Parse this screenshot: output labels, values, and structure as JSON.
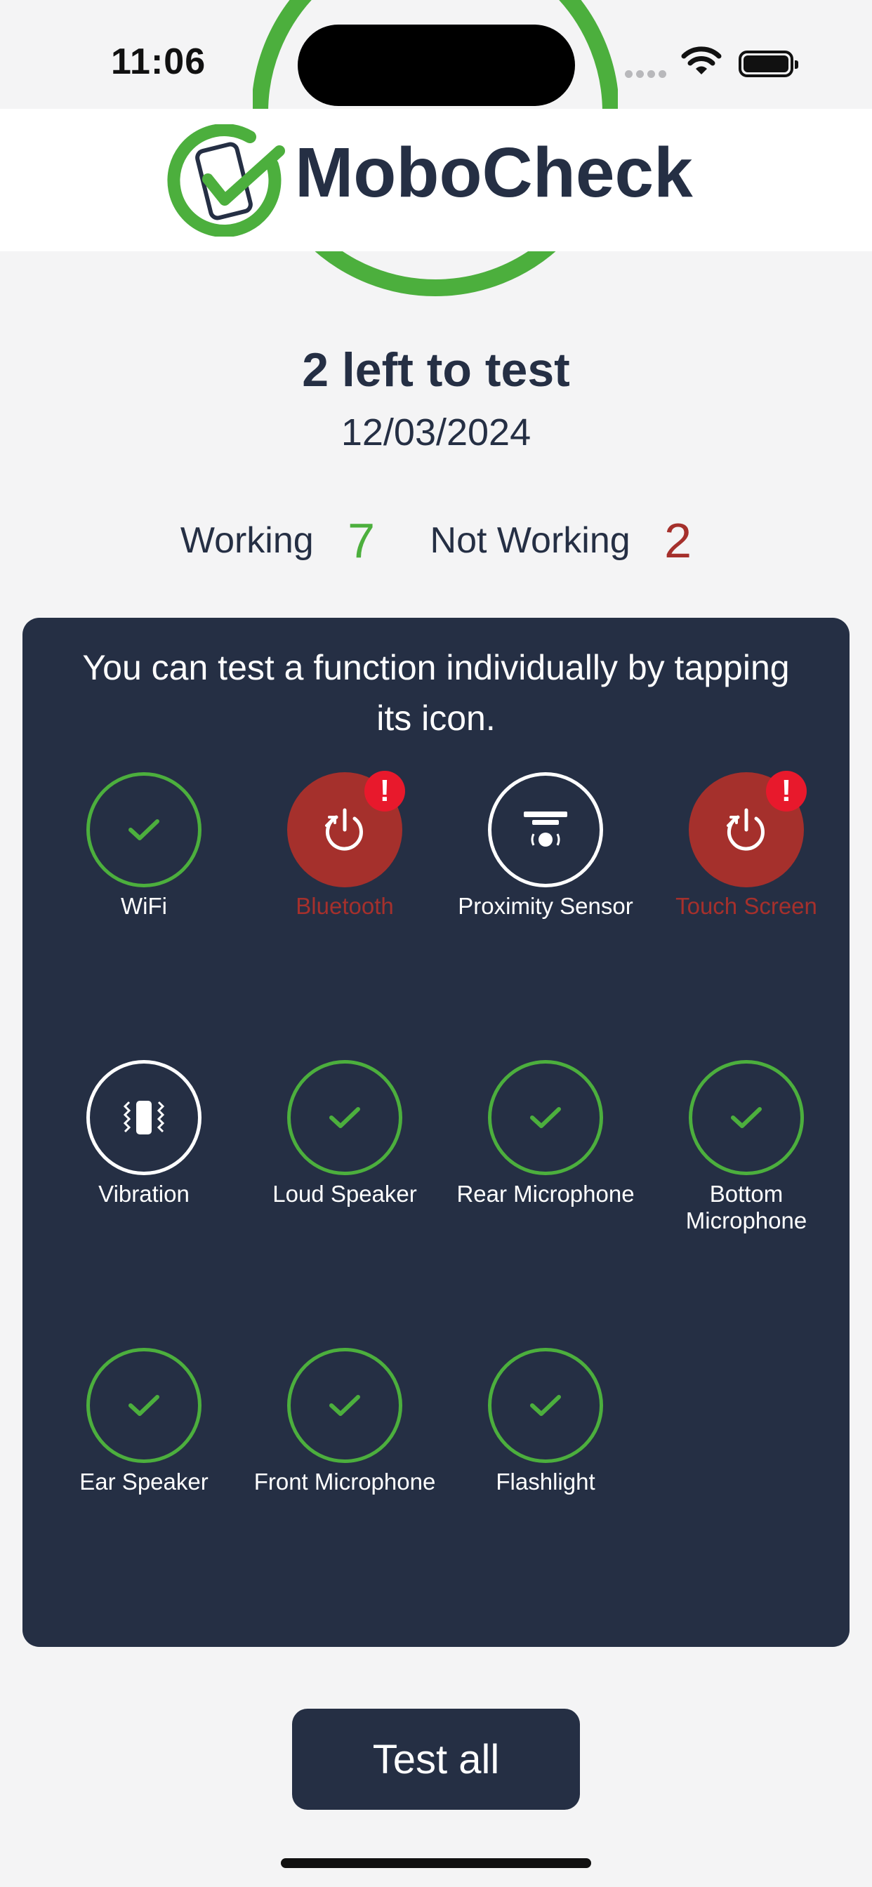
{
  "status_bar": {
    "time": "11:06"
  },
  "header": {
    "brand": "MoboCheck"
  },
  "summary": {
    "remaining": "2 left to test",
    "date": "12/03/2024",
    "working_label": "Working",
    "working_count": "7",
    "not_working_label": "Not Working",
    "not_working_count": "2"
  },
  "panel": {
    "instruction": "You can  test a function individually by tapping its icon.",
    "tests": [
      {
        "label": "WiFi",
        "status": "pass",
        "icon": "check-icon"
      },
      {
        "label": "Bluetooth",
        "status": "fail",
        "icon": "power-retry-icon",
        "alert": "!"
      },
      {
        "label": "Proximity Sensor",
        "status": "untested",
        "icon": "proximity-sensor-icon"
      },
      {
        "label": "Touch Screen",
        "status": "fail",
        "icon": "power-retry-icon",
        "alert": "!"
      },
      {
        "label": "Vibration",
        "status": "untested",
        "icon": "vibration-icon"
      },
      {
        "label": "Loud Speaker",
        "status": "pass",
        "icon": "check-icon"
      },
      {
        "label": "Rear Microphone",
        "status": "pass",
        "icon": "check-icon"
      },
      {
        "label": "Bottom Microphone",
        "status": "pass",
        "icon": "check-icon"
      },
      {
        "label": "Ear Speaker",
        "status": "pass",
        "icon": "check-icon"
      },
      {
        "label": "Front Microphone",
        "status": "pass",
        "icon": "check-icon"
      },
      {
        "label": "Flashlight",
        "status": "pass",
        "icon": "check-icon"
      }
    ]
  },
  "actions": {
    "test_all": "Test all"
  },
  "colors": {
    "navy": "#252f44",
    "pass_green": "#4caf3d",
    "fail_red": "#a5302c",
    "alert_red": "#e8192c"
  }
}
